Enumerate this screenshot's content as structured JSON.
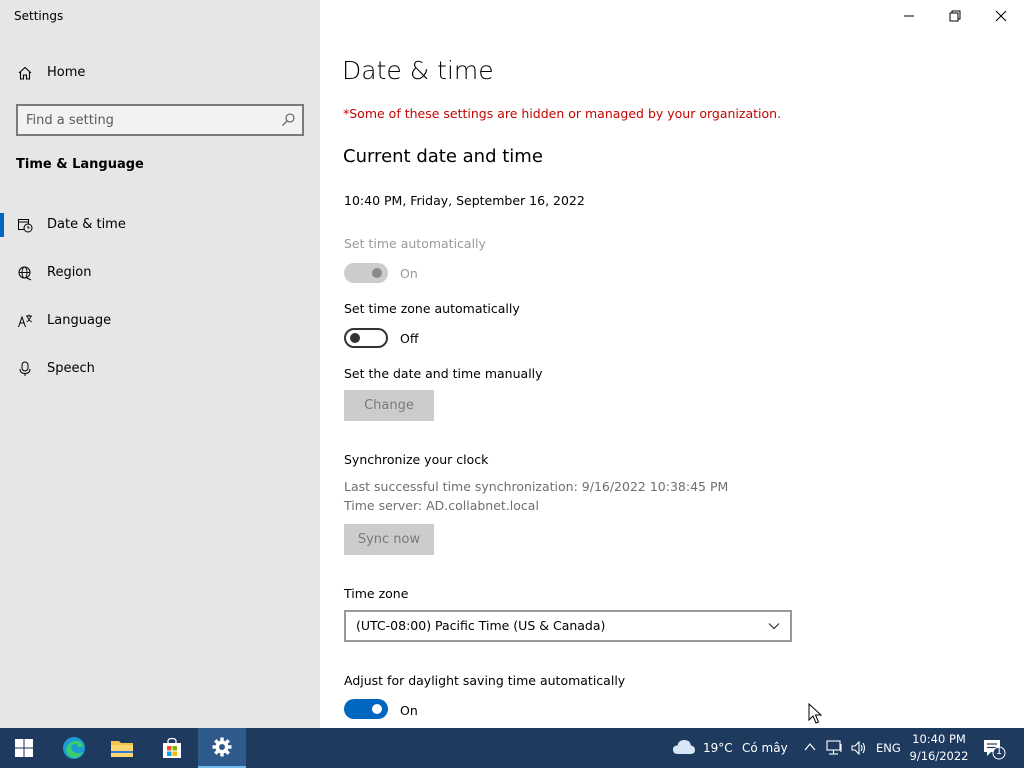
{
  "app": {
    "title": "Settings"
  },
  "sidebar": {
    "home_label": "Home",
    "search_placeholder": "Find a setting",
    "section_title": "Time & Language",
    "items": [
      {
        "label": "Date & time",
        "icon": "calendar-clock-icon",
        "active": true
      },
      {
        "label": "Region",
        "icon": "globe-icon",
        "active": false
      },
      {
        "label": "Language",
        "icon": "language-icon",
        "active": false
      },
      {
        "label": "Speech",
        "icon": "microphone-icon",
        "active": false
      }
    ]
  },
  "main": {
    "title": "Date & time",
    "org_note": "*Some of these settings are hidden or managed by your organization.",
    "current_heading": "Current date and time",
    "current_datetime": "10:40 PM, Friday, September 16, 2022",
    "set_time_auto": {
      "label": "Set time automatically",
      "state": "On"
    },
    "set_tz_auto": {
      "label": "Set time zone automatically",
      "state": "Off"
    },
    "manual": {
      "label": "Set the date and time manually",
      "button": "Change"
    },
    "sync": {
      "heading": "Synchronize your clock",
      "last_sync": "Last successful time synchronization: 9/16/2022 10:38:45 PM",
      "server": "Time server: AD.collabnet.local",
      "button": "Sync now"
    },
    "timezone": {
      "label": "Time zone",
      "value": "(UTC-08:00) Pacific Time (US & Canada)"
    },
    "dst": {
      "label": "Adjust for daylight saving time automatically",
      "state": "On"
    }
  },
  "taskbar": {
    "weather_temp": "19°C",
    "weather_desc": "Có mây",
    "language": "ENG",
    "time": "10:40 PM",
    "date": "9/16/2022",
    "notification_count": "1"
  },
  "colors": {
    "accent": "#0067c0",
    "warning": "#c50500",
    "taskbar": "#1f3a5f"
  }
}
